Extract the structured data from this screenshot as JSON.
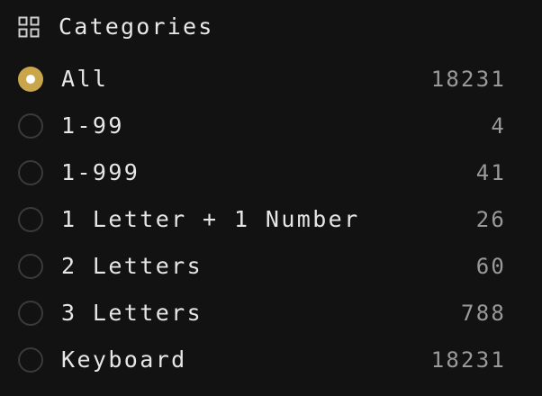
{
  "header": {
    "title": "Categories",
    "icon": "grid-icon"
  },
  "accent_color": "#c9a54b",
  "categories": [
    {
      "label": "All",
      "count": "18231",
      "selected": true
    },
    {
      "label": "1-99",
      "count": "4",
      "selected": false
    },
    {
      "label": "1-999",
      "count": "41",
      "selected": false
    },
    {
      "label": "1 Letter + 1 Number",
      "count": "26",
      "selected": false
    },
    {
      "label": "2 Letters",
      "count": "60",
      "selected": false
    },
    {
      "label": "3 Letters",
      "count": "788",
      "selected": false
    },
    {
      "label": "Keyboard",
      "count": "18231",
      "selected": false
    }
  ]
}
